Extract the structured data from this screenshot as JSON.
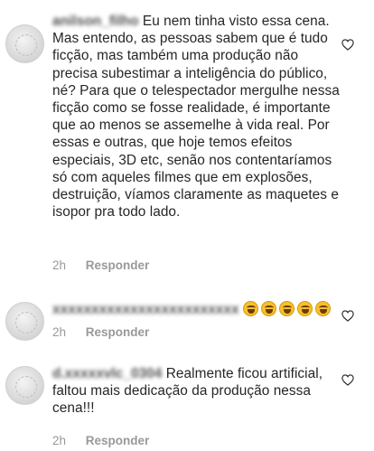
{
  "comments": [
    {
      "username": "anilson_filho",
      "text": "Eu nem tinha visto essa cena. Mas entendo, as pessoas sabem que é tudo ficção, mas também uma produção não precisa subestimar a inteligência do público, né? Para que o telespectador mergulhe nessa ficção como se fosse realidade, é importante que ao menos se assemelhe à vida real. Por essas e outras, que hoje temos efeitos especiais, 3D etc, senão nos contentaríamos só com aqueles filmes que em explosões, destruição, víamos claramente as maquetes e isopor pra todo lado.",
      "time": "2h",
      "reply_label": "Responder"
    },
    {
      "username": "xxxxxxxxxxxxxxxxxxxxxxxx",
      "emoji_count": 5,
      "emoji_icon": "face-with-tears-of-joy-icon",
      "time": "2h",
      "reply_label": "Responder"
    },
    {
      "username": "d.xxxxxvlc_0304",
      "text": "Realmente ficou artificial, faltou mais dedicação da produção nessa cena!!!",
      "time": "2h",
      "reply_label": "Responder"
    }
  ],
  "heart_icon": "heart-outline-icon",
  "colors": {
    "text": "#262626",
    "meta": "#999999",
    "background": "#ffffff"
  }
}
